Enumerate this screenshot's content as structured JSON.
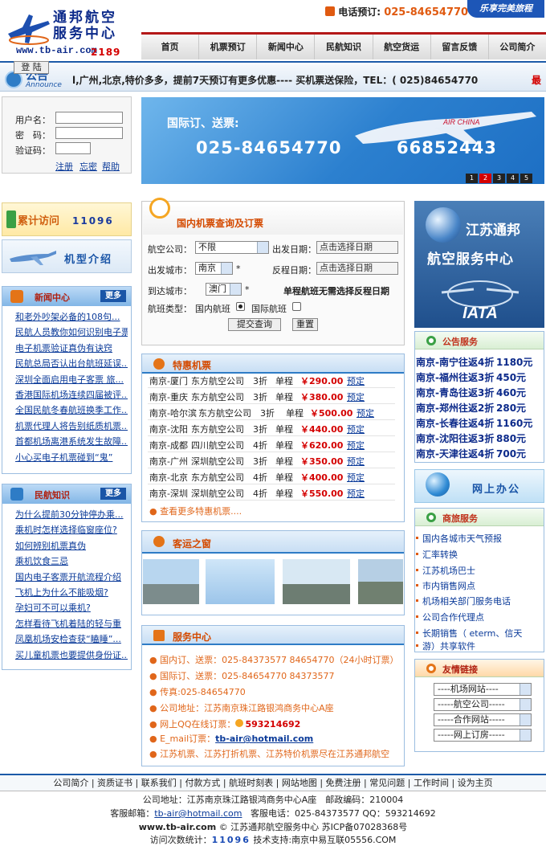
{
  "header": {
    "logo_line1": "通邦航空",
    "logo_line2": "服务中心",
    "logo_url": "www.tb-air.com",
    "phone_label": "电话预订:",
    "phone_number": "025-84654770",
    "slogan": "乐享完美旅程"
  },
  "nav": [
    "首页",
    "机票预订",
    "新闻中心",
    "民航知识",
    "航空货运",
    "留言反馈",
    "公司简介"
  ],
  "announcement": {
    "title": "公告",
    "subtitle": "Announce",
    "text": "l,广州,北京,特价多多，提前7天预订有更多优惠---- 买机票送保险，TEL：( 025)84654770",
    "trailing": "最"
  },
  "login": {
    "username_label": "用户名：",
    "password_label": "密　码：",
    "captcha_label": "验证码：",
    "captcha_value": "2189",
    "login_button": "登 陆",
    "register_link": "注册",
    "forgot_link": "忘密",
    "help_link": "帮助"
  },
  "banner": {
    "text1": "国际订、送票:",
    "phone1": "025-84654770",
    "phone2": "66852443",
    "plane_label": "AIR CHINA",
    "pages": [
      "1",
      "2",
      "3",
      "4",
      "5"
    ],
    "active_page": 2
  },
  "visits": {
    "label": "累计访问",
    "count": "11096"
  },
  "model_intro": {
    "label": "机型介绍"
  },
  "news": {
    "title": "新闻中心",
    "more": "更多",
    "items": [
      "和老外吵架必备的108句...",
      "民航人员教你如何识别电子票",
      "电子机票验证真伪有诀窍",
      "民航总局否认出台航班延误...",
      "深圳全面启用电子客票 旅...",
      "香港国际机场连续四届被评...",
      "全国民航冬春航班换季工作...",
      "机票代理人将告别纸质机票...",
      "首都机场离港系统发生故障...",
      "小心买电子机票碰到“鬼”"
    ]
  },
  "knowledge": {
    "title": "民航知识",
    "more": "更多",
    "items": [
      "为什么提前30分钟停办乘...",
      "乘机时怎样选择临窗座位?",
      "如何辨别机票真伪",
      "乘机饮食三忌",
      "国内电子客票开航流程介绍",
      "飞机上为什么不能吸烟?",
      "孕妇可不可以乘机?",
      "怎样看待飞机着陆的轻与重",
      "凤凰机场安检查获“瞌睡”...",
      "买儿童机票也要提供身份证..."
    ]
  },
  "query": {
    "title": "国内机票查询及订票",
    "airline_label": "航空公司：",
    "airline_value": "不限",
    "depart_date_label": "出发日期：",
    "depart_date_placeholder": "点击选择日期",
    "from_label": "出发城市：",
    "from_value": "南京",
    "return_date_label": "反程日期：",
    "return_date_placeholder": "点击选择日期",
    "to_label": "到达城市：",
    "to_value": "澳门",
    "oneway_note": "单程航班无需选择反程日期",
    "type_label": "航班类型：",
    "type_domestic": "国内航班",
    "type_international": "国际航班",
    "submit": "提交查询",
    "reset": "重置",
    "required_mark": "*"
  },
  "specials": {
    "title": "特惠机票",
    "more_link": "查看更多特惠机票....",
    "book_label": "预定",
    "rows": [
      {
        "route": "南京-厦门",
        "airline": "东方航空公司",
        "discount": "3折",
        "type": "单程",
        "price": "￥290.00"
      },
      {
        "route": "南京-重庆",
        "airline": "东方航空公司",
        "discount": "3折",
        "type": "单程",
        "price": "￥380.00"
      },
      {
        "route": "南京-哈尔滨",
        "airline": "东方航空公司",
        "discount": "3折",
        "type": "单程",
        "price": "￥500.00"
      },
      {
        "route": "南京-沈阳",
        "airline": "东方航空公司",
        "discount": "3折",
        "type": "单程",
        "price": "￥440.00"
      },
      {
        "route": "南京-成都",
        "airline": "四川航空公司",
        "discount": "4折",
        "type": "单程",
        "price": "￥620.00"
      },
      {
        "route": "南京-广州",
        "airline": "深圳航空公司",
        "discount": "3折",
        "type": "单程",
        "price": "￥350.00"
      },
      {
        "route": "南京-北京",
        "airline": "东方航空公司",
        "discount": "4折",
        "type": "单程",
        "price": "￥400.00"
      },
      {
        "route": "南京-深圳",
        "airline": "深圳航空公司",
        "discount": "4折",
        "type": "单程",
        "price": "￥550.00"
      }
    ]
  },
  "transport": {
    "title": "客运之窗"
  },
  "service": {
    "title": "服务中心",
    "line1": "国内订、送票：025-84373577 84654770（24小时订票）",
    "line2": "国际订、送票：025-84654770 84373577",
    "line3": "传真:025-84654770",
    "line4": "公司地址：江苏南京珠江路银鸿商务中心A座",
    "line5_label": "网上QQ在线订票：",
    "line5_value": "593214692",
    "line6_label": "E_mail订票：",
    "line6_value": "tb-air@hotmail.com",
    "line7": "江苏机票、江苏打折机票、江苏特价机票尽在江苏通邦航空"
  },
  "right_logo": {
    "line1": "江苏通邦",
    "line2": "航空服务中心",
    "iata": "IATA"
  },
  "notices": {
    "title": "公告服务",
    "items": [
      {
        "route": "南京-南宁往返4折",
        "price": "1180元"
      },
      {
        "route": "南京-福州往返3折",
        "price": "450元"
      },
      {
        "route": "南京-青岛往返3折",
        "price": "460元"
      },
      {
        "route": "南京-郑州往返2折",
        "price": "280元"
      },
      {
        "route": "南京-长春往返4折",
        "price": "1160元"
      },
      {
        "route": "南京-沈阳往返3折",
        "price": "880元"
      },
      {
        "route": "南京-天津往返4折",
        "price": "700元"
      }
    ]
  },
  "online_office": {
    "label": "网上办公"
  },
  "business": {
    "title": "商旅服务",
    "items": [
      "国内各城市天气预报",
      "汇率转换",
      "江苏机场巴士",
      "市内销售网点",
      "机场相关部门服务电话",
      "公司合作代理点",
      "长期销售（ eterm、信天",
      "游）共享软件"
    ]
  },
  "links": {
    "title": "友情链接",
    "options": [
      "----机场网站----",
      "-----航空公司-----",
      "-----合作网站-----",
      "-----网上订房-----"
    ]
  },
  "footer": {
    "links": [
      "公司简介",
      "资质证书",
      "联系我们",
      "付款方式",
      "航班时刻表",
      "网站地图",
      "免费注册",
      "常见问题",
      "工作时间",
      "设为主页"
    ],
    "address": "公司地址：江苏南京珠江路银鸿商务中心A座　邮政编码：210004",
    "email_label": "客服邮箱：",
    "email": "tb-air@hotmail.com",
    "phone_text": "客服电话：025-84373577 QQ：593214692",
    "site": "www.tb-air.com",
    "copyright_rest": "© 江苏通邦航空服务中心 苏ICP备07028368号",
    "visits_label": "访问次数统计：",
    "visits_count": "11096",
    "support": "技术支持:南京中易互联05556.COM"
  },
  "colors": {
    "brand_blue": "#1c5aa8",
    "accent_red": "#d40000",
    "accent_orange": "#e05a10"
  }
}
